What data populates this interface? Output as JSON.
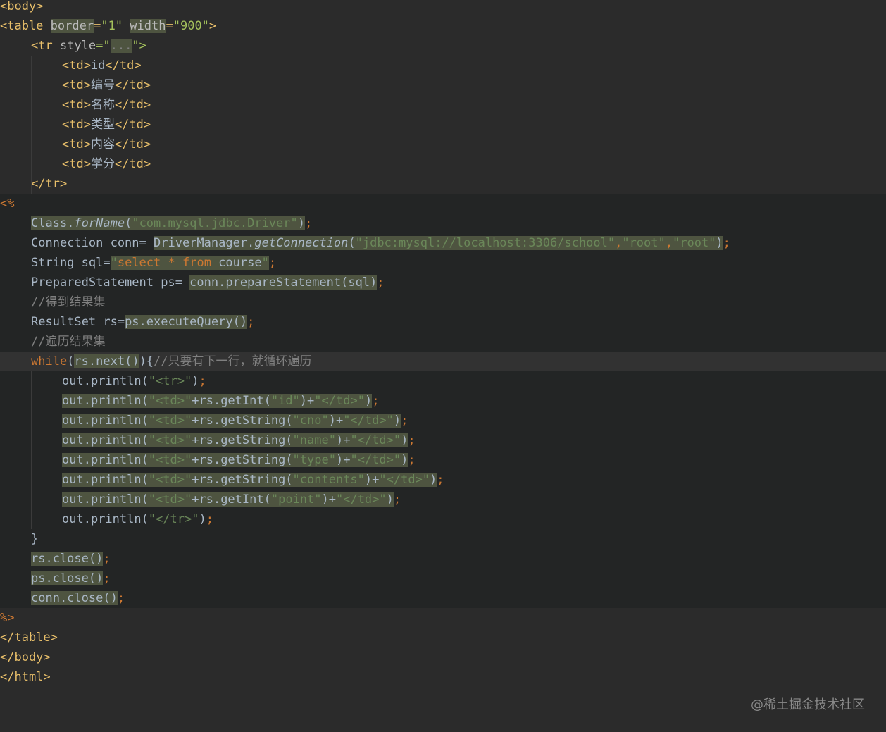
{
  "theme": {
    "background": "#2b2b2b",
    "scriptlet_background": "#232525",
    "current_line_background": "#323232",
    "default_text": "#a9b7c6",
    "tag_color": "#e8bf6a",
    "attr_name_color": "#bababa",
    "attr_value_color": "#a5c25c",
    "string_color": "#6a8759",
    "keyword_color": "#cc7832",
    "comment_color": "#808080",
    "method_italic_color": "#a9b7c6",
    "highlight_background": "#4e5440"
  },
  "code_lines": [
    {
      "indent": 0,
      "bg": "",
      "tokens": [
        {
          "t": "<body>",
          "c": "tag"
        }
      ]
    },
    {
      "indent": 0,
      "bg": "",
      "tokens": [
        {
          "t": "<table ",
          "c": "tag"
        },
        {
          "t": "border",
          "c": "attr",
          "hl": true
        },
        {
          "t": "=",
          "c": "tag"
        },
        {
          "t": "\"1\"",
          "c": "val"
        },
        {
          "t": " ",
          "c": "tag"
        },
        {
          "t": "width",
          "c": "attr",
          "hl": true
        },
        {
          "t": "=",
          "c": "tag"
        },
        {
          "t": "\"900\"",
          "c": "val"
        },
        {
          "t": ">",
          "c": "tag"
        }
      ]
    },
    {
      "indent": 4,
      "bg": "",
      "tokens": [
        {
          "t": "<tr ",
          "c": "tag"
        },
        {
          "t": "style",
          "c": "attr"
        },
        {
          "t": "=\"",
          "c": "val"
        },
        {
          "t": "...",
          "c": "comment",
          "hl": true
        },
        {
          "t": "\">",
          "c": "val"
        }
      ]
    },
    {
      "indent": 8,
      "bg": "",
      "tokens": [
        {
          "t": "<td>",
          "c": "tag"
        },
        {
          "t": "id",
          "c": "text"
        },
        {
          "t": "</td>",
          "c": "tag"
        }
      ]
    },
    {
      "indent": 8,
      "bg": "",
      "tokens": [
        {
          "t": "<td>",
          "c": "tag"
        },
        {
          "t": "编号",
          "c": "text"
        },
        {
          "t": "</td>",
          "c": "tag"
        }
      ]
    },
    {
      "indent": 8,
      "bg": "",
      "tokens": [
        {
          "t": "<td>",
          "c": "tag"
        },
        {
          "t": "名称",
          "c": "text"
        },
        {
          "t": "</td>",
          "c": "tag"
        }
      ]
    },
    {
      "indent": 8,
      "bg": "",
      "tokens": [
        {
          "t": "<td>",
          "c": "tag"
        },
        {
          "t": "类型",
          "c": "text"
        },
        {
          "t": "</td>",
          "c": "tag"
        }
      ]
    },
    {
      "indent": 8,
      "bg": "",
      "tokens": [
        {
          "t": "<td>",
          "c": "tag"
        },
        {
          "t": "内容",
          "c": "text"
        },
        {
          "t": "</td>",
          "c": "tag"
        }
      ]
    },
    {
      "indent": 8,
      "bg": "",
      "tokens": [
        {
          "t": "<td>",
          "c": "tag"
        },
        {
          "t": "学分",
          "c": "text"
        },
        {
          "t": "</td>",
          "c": "tag"
        }
      ]
    },
    {
      "indent": 4,
      "bg": "",
      "tokens": [
        {
          "t": "</tr>",
          "c": "tag"
        }
      ]
    },
    {
      "indent": 0,
      "bg": "scriptlet",
      "tokens": [
        {
          "t": "<%",
          "c": "kw"
        }
      ]
    },
    {
      "indent": 4,
      "bg": "scriptlet",
      "tokens": [
        {
          "t": "Class.",
          "c": "text",
          "hl": true
        },
        {
          "t": "forName",
          "c": "italic",
          "hl": true
        },
        {
          "t": "(",
          "c": "text",
          "hl": true
        },
        {
          "t": "\"com.mysql.jdbc.Driver\"",
          "c": "str",
          "hl": true
        },
        {
          "t": ")",
          "c": "text",
          "hl": true
        },
        {
          "t": ";",
          "c": "kw"
        }
      ]
    },
    {
      "indent": 4,
      "bg": "scriptlet",
      "tokens": [
        {
          "t": "Connection conn= ",
          "c": "text"
        },
        {
          "t": "DriverManager.",
          "c": "text",
          "hl": true
        },
        {
          "t": "getConnection",
          "c": "italic",
          "hl": true
        },
        {
          "t": "(",
          "c": "text",
          "hl": true
        },
        {
          "t": "\"jdbc:mysql://localhost:3306/school\"",
          "c": "str",
          "hl": true
        },
        {
          "t": ",",
          "c": "kw",
          "hl": true
        },
        {
          "t": "\"root\"",
          "c": "str",
          "hl": true
        },
        {
          "t": ",",
          "c": "kw",
          "hl": true
        },
        {
          "t": "\"root\"",
          "c": "str",
          "hl": true
        },
        {
          "t": ")",
          "c": "text",
          "hl": true
        },
        {
          "t": ";",
          "c": "kw"
        }
      ]
    },
    {
      "indent": 4,
      "bg": "scriptlet",
      "tokens": [
        {
          "t": "String sql=",
          "c": "text"
        },
        {
          "t": "\"",
          "c": "str",
          "hl": true
        },
        {
          "t": "select",
          "c": "kw",
          "hl": true
        },
        {
          "t": " * ",
          "c": "kw",
          "hl": true
        },
        {
          "t": "from",
          "c": "kw",
          "hl": true
        },
        {
          "t": " course",
          "c": "text",
          "hl": true
        },
        {
          "t": "\"",
          "c": "str",
          "hl": true
        },
        {
          "t": ";",
          "c": "kw"
        }
      ]
    },
    {
      "indent": 4,
      "bg": "scriptlet",
      "tokens": [
        {
          "t": "PreparedStatement ps= ",
          "c": "text"
        },
        {
          "t": "conn.prepareStatement(sql)",
          "c": "text",
          "hl": true
        },
        {
          "t": ";",
          "c": "kw"
        }
      ]
    },
    {
      "indent": 4,
      "bg": "scriptlet",
      "tokens": [
        {
          "t": "//得到结果集",
          "c": "comment"
        }
      ]
    },
    {
      "indent": 4,
      "bg": "scriptlet",
      "tokens": [
        {
          "t": "ResultSet rs=",
          "c": "text"
        },
        {
          "t": "ps.executeQuery()",
          "c": "text",
          "hl": true
        },
        {
          "t": ";",
          "c": "kw"
        }
      ]
    },
    {
      "indent": 4,
      "bg": "scriptlet",
      "tokens": [
        {
          "t": "//遍历结果集",
          "c": "comment"
        }
      ]
    },
    {
      "indent": 4,
      "bg": "current",
      "tokens": [
        {
          "t": "while",
          "c": "kw"
        },
        {
          "t": "(",
          "c": "text"
        },
        {
          "t": "rs.next()",
          "c": "text",
          "hl": true
        },
        {
          "t": "){",
          "c": "text"
        },
        {
          "t": "//只要有下一行，就循环遍历",
          "c": "comment"
        }
      ]
    },
    {
      "indent": 8,
      "bg": "scriptlet",
      "tokens": [
        {
          "t": "out.println(",
          "c": "text"
        },
        {
          "t": "\"<tr>\"",
          "c": "str"
        },
        {
          "t": ")",
          "c": "text"
        },
        {
          "t": ";",
          "c": "kw"
        }
      ]
    },
    {
      "indent": 8,
      "bg": "scriptlet",
      "tokens": [
        {
          "t": "out.println(",
          "c": "text",
          "hl": true
        },
        {
          "t": "\"<td>\"",
          "c": "str",
          "hl": true
        },
        {
          "t": "+rs.getInt(",
          "c": "text",
          "hl": true
        },
        {
          "t": "\"id\"",
          "c": "str",
          "hl": true
        },
        {
          "t": ")+",
          "c": "text",
          "hl": true
        },
        {
          "t": "\"</td>\"",
          "c": "str",
          "hl": true
        },
        {
          "t": ")",
          "c": "text",
          "hl": true
        },
        {
          "t": ";",
          "c": "kw"
        }
      ]
    },
    {
      "indent": 8,
      "bg": "scriptlet",
      "tokens": [
        {
          "t": "out.println(",
          "c": "text",
          "hl": true
        },
        {
          "t": "\"<td>\"",
          "c": "str",
          "hl": true
        },
        {
          "t": "+rs.getString(",
          "c": "text",
          "hl": true
        },
        {
          "t": "\"cno\"",
          "c": "str",
          "hl": true
        },
        {
          "t": ")+",
          "c": "text",
          "hl": true
        },
        {
          "t": "\"</td>\"",
          "c": "str",
          "hl": true
        },
        {
          "t": ")",
          "c": "text",
          "hl": true
        },
        {
          "t": ";",
          "c": "kw"
        }
      ]
    },
    {
      "indent": 8,
      "bg": "scriptlet",
      "tokens": [
        {
          "t": "out.println(",
          "c": "text",
          "hl": true
        },
        {
          "t": "\"<td>\"",
          "c": "str",
          "hl": true
        },
        {
          "t": "+rs.getString(",
          "c": "text",
          "hl": true
        },
        {
          "t": "\"name\"",
          "c": "str",
          "hl": true
        },
        {
          "t": ")+",
          "c": "text",
          "hl": true
        },
        {
          "t": "\"</td>\"",
          "c": "str",
          "hl": true
        },
        {
          "t": ")",
          "c": "text",
          "hl": true
        },
        {
          "t": ";",
          "c": "kw"
        }
      ]
    },
    {
      "indent": 8,
      "bg": "scriptlet",
      "tokens": [
        {
          "t": "out.println(",
          "c": "text",
          "hl": true
        },
        {
          "t": "\"<td>\"",
          "c": "str",
          "hl": true
        },
        {
          "t": "+rs.getString(",
          "c": "text",
          "hl": true
        },
        {
          "t": "\"type\"",
          "c": "str",
          "hl": true
        },
        {
          "t": ")+",
          "c": "text",
          "hl": true
        },
        {
          "t": "\"</td>\"",
          "c": "str",
          "hl": true
        },
        {
          "t": ")",
          "c": "text",
          "hl": true
        },
        {
          "t": ";",
          "c": "kw"
        }
      ]
    },
    {
      "indent": 8,
      "bg": "scriptlet",
      "tokens": [
        {
          "t": "out.println(",
          "c": "text",
          "hl": true
        },
        {
          "t": "\"<td>\"",
          "c": "str",
          "hl": true
        },
        {
          "t": "+rs.getString(",
          "c": "text",
          "hl": true
        },
        {
          "t": "\"contents\"",
          "c": "str",
          "hl": true
        },
        {
          "t": ")+",
          "c": "text",
          "hl": true
        },
        {
          "t": "\"</td>\"",
          "c": "str",
          "hl": true
        },
        {
          "t": ")",
          "c": "text",
          "hl": true
        },
        {
          "t": ";",
          "c": "kw"
        }
      ]
    },
    {
      "indent": 8,
      "bg": "scriptlet",
      "tokens": [
        {
          "t": "out.println(",
          "c": "text",
          "hl": true
        },
        {
          "t": "\"<td>\"",
          "c": "str",
          "hl": true
        },
        {
          "t": "+rs.getInt(",
          "c": "text",
          "hl": true
        },
        {
          "t": "\"point\"",
          "c": "str",
          "hl": true
        },
        {
          "t": ")+",
          "c": "text",
          "hl": true
        },
        {
          "t": "\"</td>\"",
          "c": "str",
          "hl": true
        },
        {
          "t": ")",
          "c": "text",
          "hl": true
        },
        {
          "t": ";",
          "c": "kw"
        }
      ]
    },
    {
      "indent": 8,
      "bg": "scriptlet",
      "tokens": [
        {
          "t": "out.println(",
          "c": "text"
        },
        {
          "t": "\"</tr>\"",
          "c": "str"
        },
        {
          "t": ")",
          "c": "text"
        },
        {
          "t": ";",
          "c": "kw"
        }
      ]
    },
    {
      "indent": 4,
      "bg": "scriptlet",
      "tokens": [
        {
          "t": "}",
          "c": "text"
        }
      ]
    },
    {
      "indent": 4,
      "bg": "scriptlet",
      "tokens": [
        {
          "t": "rs.close()",
          "c": "text",
          "hl": true
        },
        {
          "t": ";",
          "c": "kw"
        }
      ]
    },
    {
      "indent": 4,
      "bg": "scriptlet",
      "tokens": [
        {
          "t": "ps.close()",
          "c": "text",
          "hl": true
        },
        {
          "t": ";",
          "c": "kw"
        }
      ]
    },
    {
      "indent": 4,
      "bg": "scriptlet",
      "tokens": [
        {
          "t": "conn.close()",
          "c": "text",
          "hl": true
        },
        {
          "t": ";",
          "c": "kw"
        }
      ]
    },
    {
      "indent": 0,
      "bg": "",
      "tokens": [
        {
          "t": "%>",
          "c": "kw"
        }
      ]
    },
    {
      "indent": 0,
      "bg": "",
      "tokens": [
        {
          "t": "</table>",
          "c": "tag"
        }
      ]
    },
    {
      "indent": 0,
      "bg": "",
      "tokens": [
        {
          "t": "</body>",
          "c": "tag"
        }
      ]
    },
    {
      "indent": 0,
      "bg": "",
      "tokens": [
        {
          "t": "</html>",
          "c": "tag"
        }
      ]
    }
  ],
  "watermark": "@稀土掘金技术社区"
}
